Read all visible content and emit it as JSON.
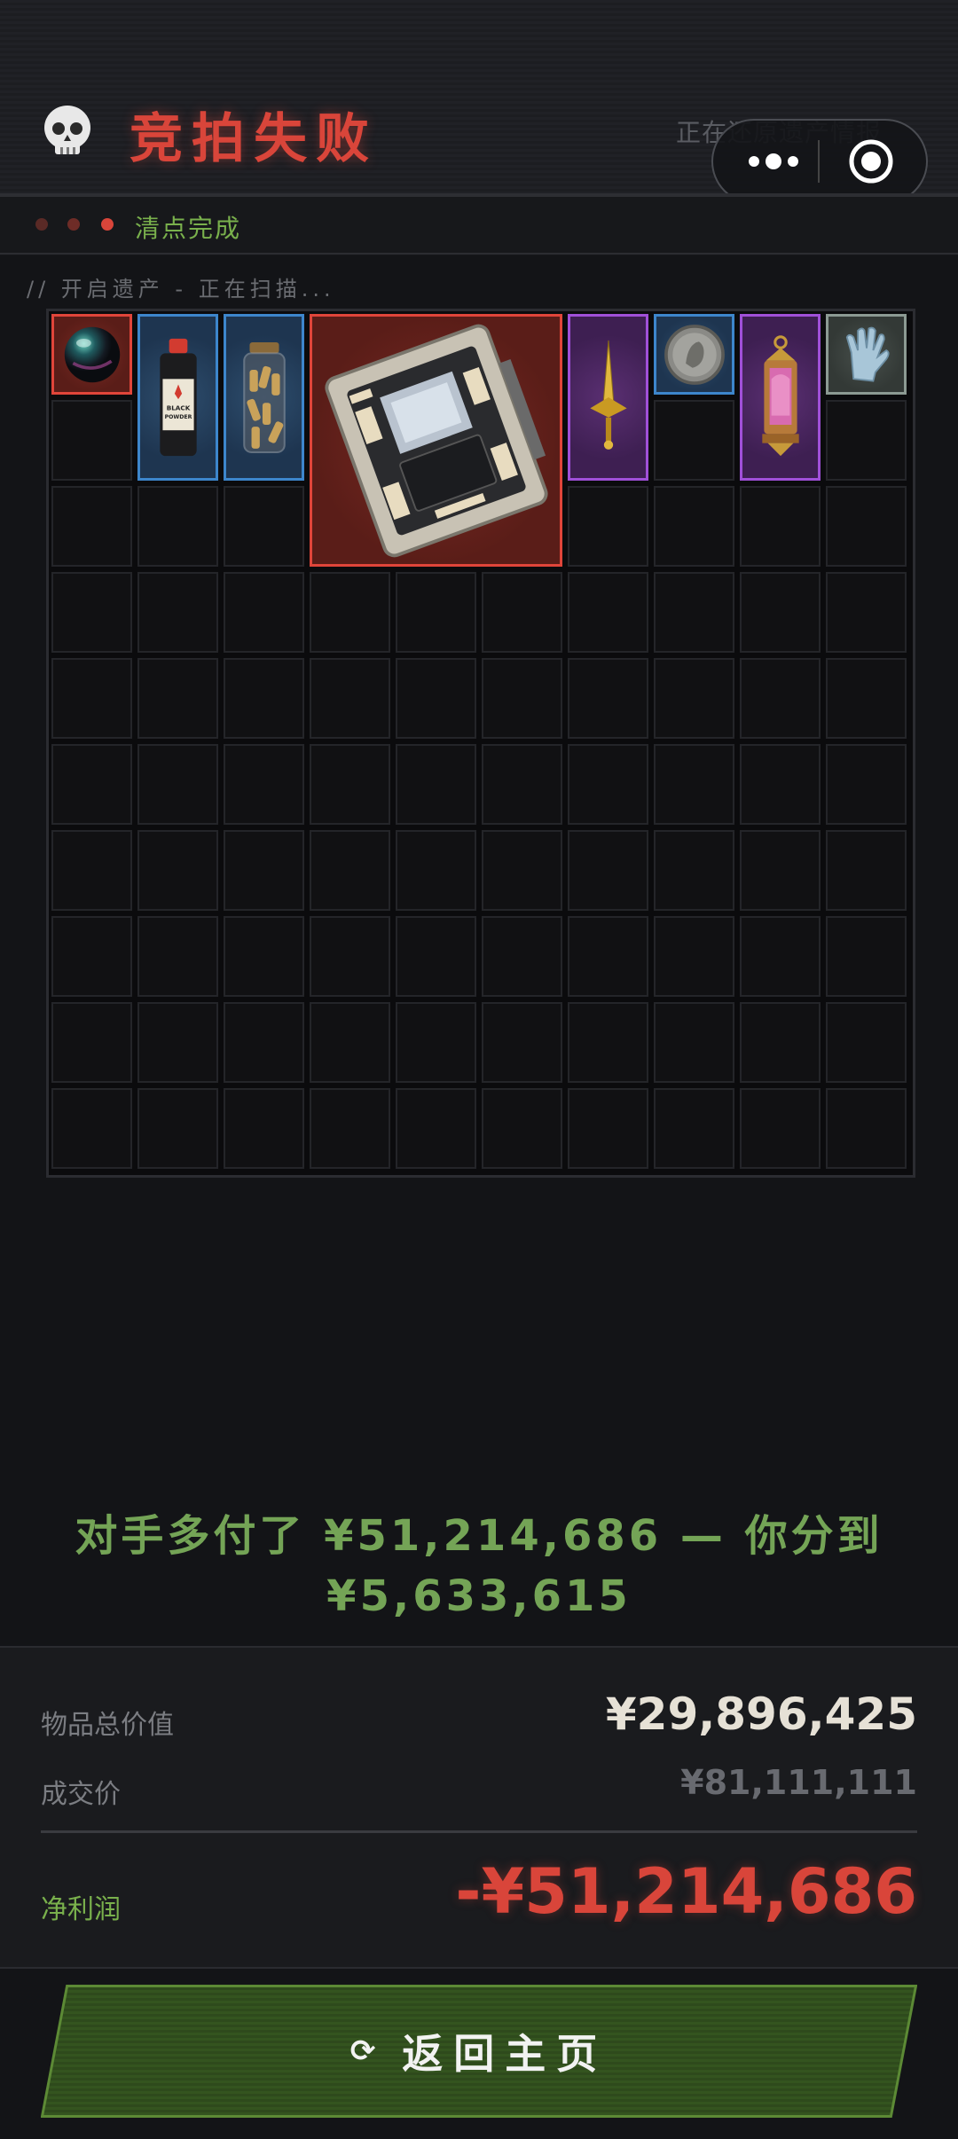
{
  "header": {
    "title": "竞拍失败",
    "restore_text": "正在还原遗产情报",
    "skull_icon": "skull-icon"
  },
  "status": {
    "label": "清点完成",
    "dots": [
      "#5a2a26",
      "#6e2c27",
      "#d9453a"
    ]
  },
  "scan_text": "// 开启遗产 - 正在扫描...",
  "inventory": {
    "rows": 10,
    "cols": 10,
    "items": [
      {
        "name": "black-pearl-orb",
        "rarity": "red",
        "col": 0,
        "row": 0,
        "w": 1,
        "h": 1
      },
      {
        "name": "black-powder-bottle",
        "rarity": "blue",
        "col": 1,
        "row": 0,
        "w": 1,
        "h": 2,
        "label": "BLACK POWDER"
      },
      {
        "name": "ammo-jar",
        "rarity": "blue",
        "col": 2,
        "row": 0,
        "w": 1,
        "h": 2
      },
      {
        "name": "graphics-card",
        "rarity": "red",
        "col": 3,
        "row": 0,
        "w": 3,
        "h": 3
      },
      {
        "name": "golden-dagger",
        "rarity": "purple",
        "col": 6,
        "row": 0,
        "w": 1,
        "h": 2
      },
      {
        "name": "silver-coin",
        "rarity": "blue",
        "col": 7,
        "row": 0,
        "w": 1,
        "h": 1
      },
      {
        "name": "ornate-lantern",
        "rarity": "purple",
        "col": 8,
        "row": 0,
        "w": 1,
        "h": 2
      },
      {
        "name": "latex-glove",
        "rarity": "gray",
        "col": 9,
        "row": 0,
        "w": 1,
        "h": 1
      }
    ]
  },
  "message": {
    "line1": "对手多付了 ¥51,214,686 — 你分到",
    "line2": "¥5,633,615"
  },
  "summary": {
    "total_value_label": "物品总价值",
    "total_value": "¥29,896,425",
    "deal_price_label": "成交价",
    "deal_price": "¥81,111,111",
    "net_profit_label": "净利润",
    "net_profit": "-¥51,214,686"
  },
  "colors": {
    "accent_red": "#d9453a",
    "accent_green": "#79b04c",
    "rarity_red": "#e0453a",
    "rarity_blue": "#3d86cc",
    "rarity_purple": "#a050d8",
    "rarity_gray": "#8c9a93"
  },
  "home_button": {
    "label": "返回主页",
    "icon": "refresh-icon"
  }
}
